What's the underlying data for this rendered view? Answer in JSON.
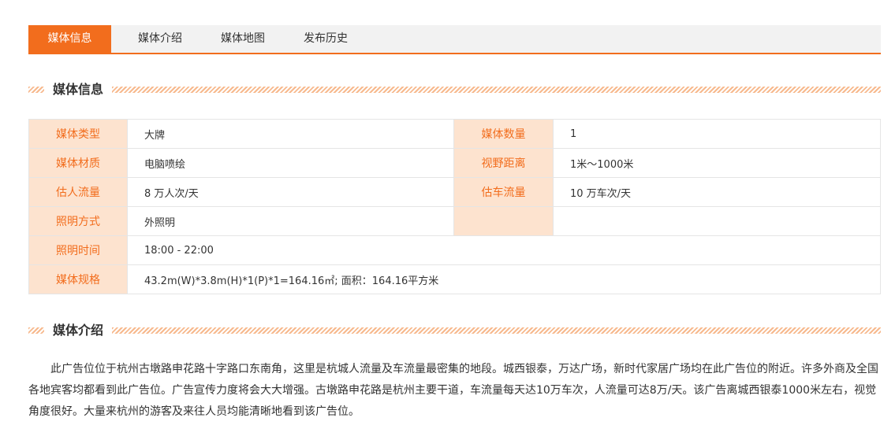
{
  "colors": {
    "accent": "#f26d1d",
    "label_bg": "#fde3cf",
    "stripe": "#f7b98d",
    "blue_button": "#3a8ee6"
  },
  "tabs": [
    {
      "label": "媒体信息",
      "active": true
    },
    {
      "label": "媒体介绍",
      "active": false
    },
    {
      "label": "媒体地图",
      "active": false
    },
    {
      "label": "发布历史",
      "active": false
    }
  ],
  "info_section": {
    "title": "媒体信息"
  },
  "info_table": {
    "media_type": {
      "label": "媒体类型",
      "value": "大牌"
    },
    "media_count": {
      "label": "媒体数量",
      "value": "1"
    },
    "material": {
      "label": "媒体材质",
      "value": "电脑喷绘"
    },
    "view_distance": {
      "label": "视野距离",
      "value": "1米～1000米"
    },
    "people_flow": {
      "label": "估人流量",
      "value": "8 万人次/天"
    },
    "car_flow": {
      "label": "估车流量",
      "value": "10 万车次/天"
    },
    "lighting": {
      "label": "照明方式",
      "value": "外照明"
    },
    "lighting_time": {
      "label": "照明时间",
      "value": "18:00 - 22:00"
    },
    "spec": {
      "label": "媒体规格",
      "value": "43.2m(W)*3.8m(H)*1(P)*1=164.16㎡; 面积：164.16平方米"
    }
  },
  "intro_section": {
    "title": "媒体介绍",
    "text": "此广告位位于杭州古墩路申花路十字路口东南角，这里是杭城人流量及车流量最密集的地段。城西银泰，万达广场，新时代家居广场均在此广告位的附近。许多外商及全国各地宾客均都看到此广告位。广告宣传力度将会大大增强。古墩路申花路是杭州主要干道，车流量每天达10万车次，人流量可达8万/天。该广告离城西银泰1000米左右，视觉角度很好。大量来杭州的游客及来往人员均能清晰地看到该广告位。"
  }
}
